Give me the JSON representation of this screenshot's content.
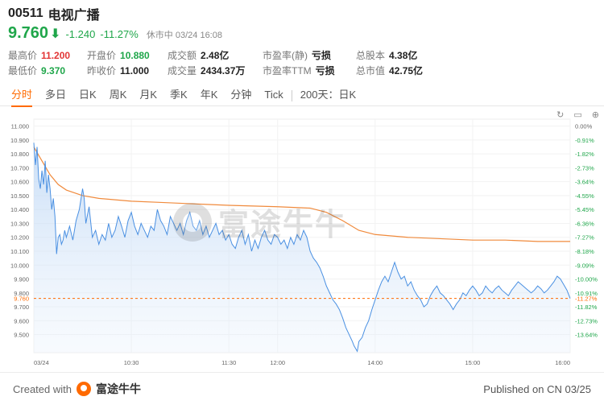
{
  "stock": {
    "code": "00511",
    "name": "电视广播",
    "price": "9.760",
    "change": "-1.240",
    "change_pct": "-11.27%",
    "status": "休市中 03/24 16:08"
  },
  "stats": {
    "high_label": "最高价",
    "high": "11.200",
    "low_label": "最低价",
    "low": "9.370",
    "open_label": "开盘价",
    "open": "10.880",
    "prev_close_label": "昨收价",
    "prev_close": "11.000",
    "turnover_label": "成交额",
    "turnover": "2.48亿",
    "volume_label": "成交量",
    "volume": "2434.37万",
    "pe_static_label": "市盈率(静)",
    "pe_static": "亏损",
    "pe_ttm_label": "市盈率TTM",
    "pe_ttm": "亏损",
    "shares_label": "总股本",
    "shares": "4.38亿",
    "mktcap_label": "总市值",
    "mktcap": "42.75亿"
  },
  "tabs": [
    "分时",
    "多日",
    "日K",
    "周K",
    "月K",
    "季K",
    "年K",
    "分钟",
    "Tick"
  ],
  "tab_extra": "200天：日K",
  "tools": [
    "↻",
    "▭",
    "⊕"
  ],
  "watermark": "富途牛牛",
  "footer": {
    "created_with": "Created with",
    "brand": "富途牛牛",
    "published": "Published on CN 03/25"
  },
  "colors": {
    "up": "#e23636",
    "down": "#1fa64a",
    "accent": "#ff6a00",
    "price_line": "#4a90e2",
    "avg_line": "#f08a3c"
  },
  "chart_data": {
    "type": "line",
    "ylim": [
      9.37,
      11.05
    ],
    "prev_close": 11.0,
    "current_price_label": "9.760",
    "current_pct_label": "-11.27%",
    "y_ticks": [
      "11.000",
      "10.900",
      "10.800",
      "10.700",
      "10.600",
      "10.500",
      "10.400",
      "10.300",
      "10.200",
      "10.100",
      "10.000",
      "9.900",
      "9.800",
      "9.700",
      "9.600",
      "9.500"
    ],
    "y_tick_values": [
      11.0,
      10.9,
      10.8,
      10.7,
      10.6,
      10.5,
      10.4,
      10.3,
      10.2,
      10.1,
      10.0,
      9.9,
      9.8,
      9.7,
      9.6,
      9.5
    ],
    "pct_ticks": [
      "0.00%",
      "-0.91%",
      "-1.82%",
      "-2.73%",
      "-3.64%",
      "-4.55%",
      "-5.45%",
      "-6.36%",
      "-7.27%",
      "-8.18%",
      "-9.09%",
      "-10.00%",
      "-10.91%",
      "-11.82%",
      "-12.73%",
      "-13.64%"
    ],
    "x_ticks": [
      "03/24",
      "10:30",
      "11:30",
      "12:00",
      "14:00",
      "15:00",
      "16:00"
    ],
    "x_tick_pos": [
      0,
      60,
      120,
      150,
      210,
      270,
      330
    ],
    "x_max": 330,
    "price": [
      [
        0,
        10.88
      ],
      [
        1,
        10.72
      ],
      [
        2,
        10.85
      ],
      [
        3,
        10.62
      ],
      [
        4,
        10.55
      ],
      [
        5,
        10.68
      ],
      [
        6,
        10.58
      ],
      [
        7,
        10.75
      ],
      [
        8,
        10.52
      ],
      [
        9,
        10.65
      ],
      [
        10,
        10.55
      ],
      [
        11,
        10.4
      ],
      [
        12,
        10.48
      ],
      [
        13,
        10.35
      ],
      [
        14,
        10.08
      ],
      [
        15,
        10.2
      ],
      [
        16,
        10.22
      ],
      [
        17,
        10.15
      ],
      [
        18,
        10.18
      ],
      [
        19,
        10.25
      ],
      [
        20,
        10.2
      ],
      [
        22,
        10.28
      ],
      [
        24,
        10.18
      ],
      [
        26,
        10.32
      ],
      [
        28,
        10.4
      ],
      [
        30,
        10.55
      ],
      [
        31,
        10.48
      ],
      [
        32,
        10.3
      ],
      [
        34,
        10.42
      ],
      [
        36,
        10.2
      ],
      [
        38,
        10.25
      ],
      [
        40,
        10.15
      ],
      [
        42,
        10.22
      ],
      [
        44,
        10.18
      ],
      [
        46,
        10.3
      ],
      [
        48,
        10.2
      ],
      [
        50,
        10.25
      ],
      [
        52,
        10.35
      ],
      [
        54,
        10.28
      ],
      [
        56,
        10.2
      ],
      [
        58,
        10.32
      ],
      [
        60,
        10.38
      ],
      [
        62,
        10.28
      ],
      [
        64,
        10.22
      ],
      [
        66,
        10.3
      ],
      [
        68,
        10.25
      ],
      [
        70,
        10.2
      ],
      [
        72,
        10.28
      ],
      [
        74,
        10.25
      ],
      [
        76,
        10.4
      ],
      [
        78,
        10.32
      ],
      [
        80,
        10.28
      ],
      [
        82,
        10.22
      ],
      [
        84,
        10.35
      ],
      [
        86,
        10.3
      ],
      [
        88,
        10.25
      ],
      [
        90,
        10.3
      ],
      [
        92,
        10.22
      ],
      [
        94,
        10.32
      ],
      [
        96,
        10.38
      ],
      [
        98,
        10.28
      ],
      [
        100,
        10.25
      ],
      [
        102,
        10.32
      ],
      [
        104,
        10.22
      ],
      [
        106,
        10.28
      ],
      [
        108,
        10.2
      ],
      [
        110,
        10.25
      ],
      [
        112,
        10.3
      ],
      [
        114,
        10.22
      ],
      [
        116,
        10.25
      ],
      [
        118,
        10.18
      ],
      [
        120,
        10.22
      ],
      [
        122,
        10.15
      ],
      [
        124,
        10.12
      ],
      [
        126,
        10.2
      ],
      [
        128,
        10.25
      ],
      [
        130,
        10.15
      ],
      [
        132,
        10.22
      ],
      [
        134,
        10.1
      ],
      [
        136,
        10.18
      ],
      [
        138,
        10.12
      ],
      [
        140,
        10.2
      ],
      [
        142,
        10.25
      ],
      [
        144,
        10.18
      ],
      [
        146,
        10.15
      ],
      [
        148,
        10.22
      ],
      [
        150,
        10.2
      ],
      [
        152,
        10.15
      ],
      [
        154,
        10.18
      ],
      [
        156,
        10.12
      ],
      [
        158,
        10.2
      ],
      [
        160,
        10.15
      ],
      [
        162,
        10.22
      ],
      [
        164,
        10.18
      ],
      [
        166,
        10.25
      ],
      [
        168,
        10.2
      ],
      [
        170,
        10.1
      ],
      [
        172,
        10.05
      ],
      [
        174,
        10.02
      ],
      [
        176,
        9.98
      ],
      [
        178,
        9.92
      ],
      [
        180,
        9.85
      ],
      [
        182,
        9.8
      ],
      [
        184,
        9.75
      ],
      [
        186,
        9.72
      ],
      [
        188,
        9.68
      ],
      [
        190,
        9.62
      ],
      [
        192,
        9.55
      ],
      [
        194,
        9.5
      ],
      [
        196,
        9.45
      ],
      [
        197,
        9.42
      ],
      [
        198,
        9.4
      ],
      [
        199,
        9.38
      ],
      [
        200,
        9.45
      ],
      [
        202,
        9.48
      ],
      [
        204,
        9.55
      ],
      [
        206,
        9.6
      ],
      [
        208,
        9.68
      ],
      [
        210,
        9.75
      ],
      [
        212,
        9.82
      ],
      [
        214,
        9.88
      ],
      [
        216,
        9.92
      ],
      [
        218,
        9.88
      ],
      [
        220,
        9.95
      ],
      [
        222,
        10.02
      ],
      [
        224,
        9.95
      ],
      [
        226,
        9.9
      ],
      [
        228,
        9.92
      ],
      [
        230,
        9.85
      ],
      [
        232,
        9.88
      ],
      [
        234,
        9.82
      ],
      [
        236,
        9.78
      ],
      [
        238,
        9.75
      ],
      [
        240,
        9.7
      ],
      [
        242,
        9.72
      ],
      [
        244,
        9.78
      ],
      [
        246,
        9.82
      ],
      [
        248,
        9.85
      ],
      [
        250,
        9.8
      ],
      [
        252,
        9.78
      ],
      [
        254,
        9.75
      ],
      [
        256,
        9.72
      ],
      [
        258,
        9.68
      ],
      [
        260,
        9.72
      ],
      [
        262,
        9.75
      ],
      [
        264,
        9.8
      ],
      [
        266,
        9.78
      ],
      [
        268,
        9.82
      ],
      [
        270,
        9.85
      ],
      [
        272,
        9.82
      ],
      [
        274,
        9.78
      ],
      [
        276,
        9.8
      ],
      [
        278,
        9.85
      ],
      [
        280,
        9.82
      ],
      [
        282,
        9.8
      ],
      [
        284,
        9.83
      ],
      [
        286,
        9.85
      ],
      [
        288,
        9.82
      ],
      [
        290,
        9.8
      ],
      [
        292,
        9.78
      ],
      [
        294,
        9.82
      ],
      [
        296,
        9.85
      ],
      [
        298,
        9.88
      ],
      [
        300,
        9.86
      ],
      [
        302,
        9.84
      ],
      [
        304,
        9.82
      ],
      [
        306,
        9.8
      ],
      [
        308,
        9.82
      ],
      [
        310,
        9.85
      ],
      [
        312,
        9.83
      ],
      [
        314,
        9.8
      ],
      [
        316,
        9.82
      ],
      [
        318,
        9.85
      ],
      [
        320,
        9.88
      ],
      [
        322,
        9.92
      ],
      [
        324,
        9.9
      ],
      [
        326,
        9.86
      ],
      [
        328,
        9.82
      ],
      [
        330,
        9.76
      ]
    ],
    "avg": [
      [
        0,
        10.85
      ],
      [
        5,
        10.75
      ],
      [
        10,
        10.65
      ],
      [
        15,
        10.58
      ],
      [
        20,
        10.54
      ],
      [
        30,
        10.5
      ],
      [
        40,
        10.48
      ],
      [
        60,
        10.46
      ],
      [
        80,
        10.45
      ],
      [
        100,
        10.44
      ],
      [
        120,
        10.43
      ],
      [
        150,
        10.42
      ],
      [
        170,
        10.41
      ],
      [
        180,
        10.38
      ],
      [
        190,
        10.32
      ],
      [
        200,
        10.25
      ],
      [
        210,
        10.22
      ],
      [
        230,
        10.2
      ],
      [
        250,
        10.19
      ],
      [
        270,
        10.18
      ],
      [
        290,
        10.18
      ],
      [
        310,
        10.17
      ],
      [
        330,
        10.17
      ]
    ]
  }
}
